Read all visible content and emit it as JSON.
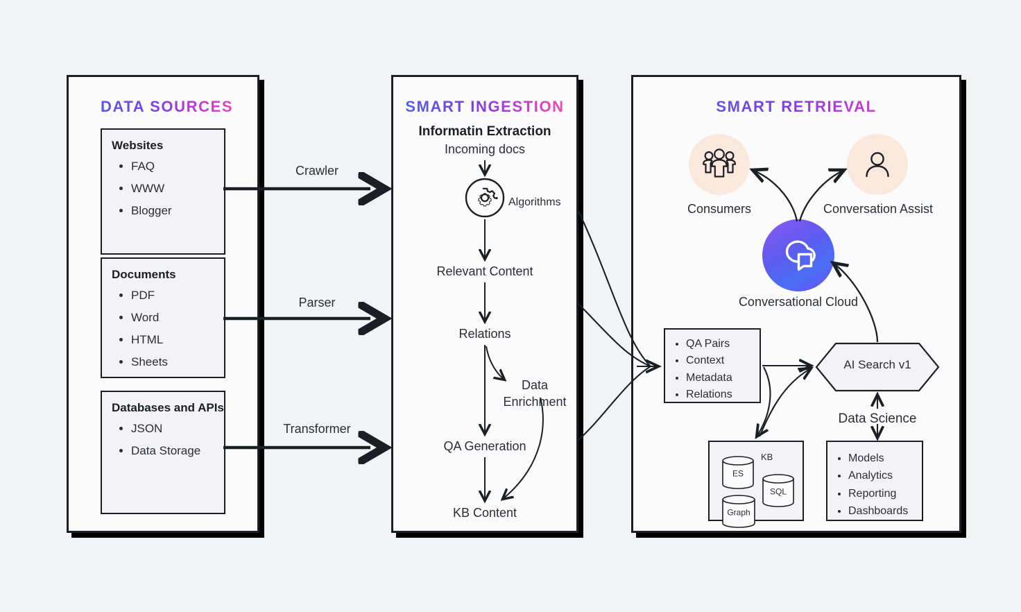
{
  "columns": {
    "sources": {
      "title": "DATA SOURCES",
      "cards": [
        {
          "heading": "Websites",
          "items": [
            "FAQ",
            "WWW",
            "Blogger"
          ]
        },
        {
          "heading": "Documents",
          "items": [
            "PDF",
            "Word",
            "HTML",
            "Sheets"
          ]
        },
        {
          "heading": "Databases and APIs",
          "items": [
            "JSON",
            "Data Storage"
          ]
        }
      ]
    },
    "ingestion": {
      "title": "SMART INGESTION",
      "subtitle": "Informatin Extraction",
      "steps": {
        "incoming": "Incoming docs",
        "algorithms": "Algorithms",
        "relevant": "Relevant Content",
        "relations": "Relations",
        "enrichment": "Data Enrichment",
        "qa_generation": "QA Generation",
        "kb_content": "KB Content"
      }
    },
    "retrieval": {
      "title": "SMART RETRIEVAL",
      "actors": [
        {
          "label": "Consumers",
          "icon": "people-group-icon"
        },
        {
          "label": "Conversation Assist",
          "icon": "person-icon"
        }
      ],
      "cloud": {
        "label": "Conversational Cloud",
        "icon": "cloud-chat-icon"
      },
      "qa_box": {
        "items": [
          "QA Pairs",
          "Context",
          "Metadata",
          "Relations"
        ]
      },
      "search": {
        "label": "AI Search v1"
      },
      "data_science": {
        "label": "Data Science"
      },
      "kb_box": {
        "label": "KB",
        "stores": [
          "ES",
          "SQL",
          "Graph"
        ]
      },
      "ds_box": {
        "items": [
          "Models",
          "Analytics",
          "Reporting",
          "Dashboards"
        ]
      }
    }
  },
  "connectors": {
    "crawler": "Crawler",
    "parser": "Parser",
    "transformer": "Transformer"
  },
  "colors": {
    "gradient_start": "#4a63f0",
    "gradient_mid": "#8a3fe0",
    "gradient_end": "#f64fb0",
    "panel_bg": "#fbfbfb",
    "card_bg": "#f3f3f5",
    "page_bg": "#f2f3f5",
    "stroke": "#1c1e26",
    "icon_circle_bg": "#fbe8dc",
    "cloud_circle": "#5a5cf0"
  }
}
